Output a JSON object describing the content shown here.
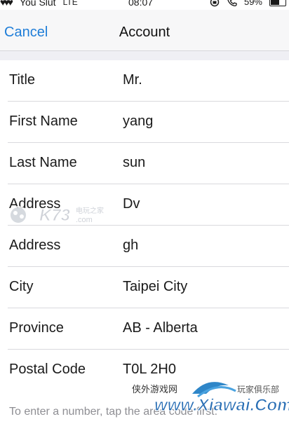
{
  "status_bar": {
    "hearts": "♥♥♥",
    "carrier": "You Slut",
    "network": "LTE",
    "time": "08:07",
    "battery": "59%"
  },
  "nav": {
    "cancel_label": "Cancel",
    "title": "Account"
  },
  "form": {
    "fields": [
      {
        "label": "Title",
        "value": "Mr."
      },
      {
        "label": "First Name",
        "value": "yang"
      },
      {
        "label": "Last Name",
        "value": "sun"
      },
      {
        "label": "Address",
        "value": "Dv"
      },
      {
        "label": "Address",
        "value": "gh"
      },
      {
        "label": "City",
        "value": "Taipei City"
      },
      {
        "label": "Province",
        "value": "AB - Alberta"
      },
      {
        "label": "Postal Code",
        "value": "T0L 2H0"
      }
    ]
  },
  "hint": "To enter a number, tap the area code first.",
  "watermarks": {
    "k73": "K73",
    "k73_cn": "电玩之家",
    "k73_domain": ".com",
    "xiawai_cn": "侠外游戏网",
    "xiawai_domain": "www.Xiawai.Com",
    "xiawai_slogan": "玩家俱乐部"
  }
}
